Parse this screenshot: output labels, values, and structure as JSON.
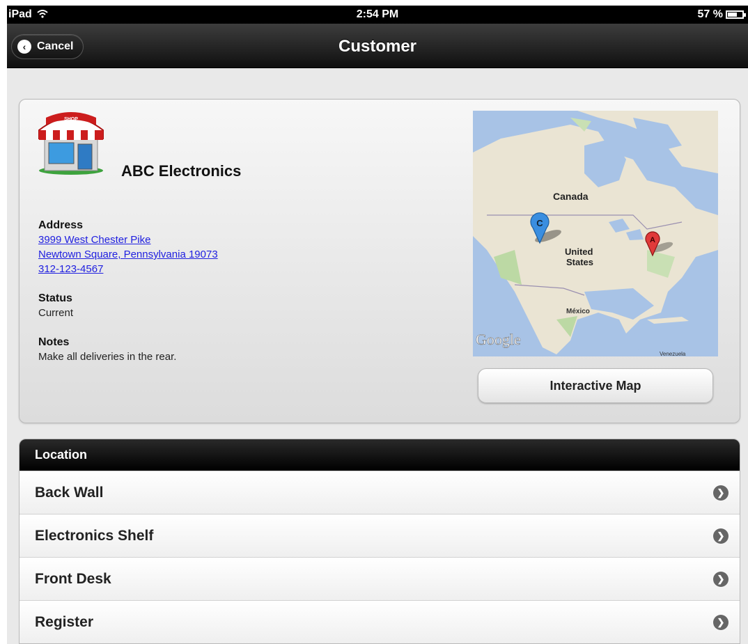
{
  "status_bar": {
    "carrier": "iPad",
    "time": "2:54 PM",
    "battery": "57 %"
  },
  "nav": {
    "cancel_label": "Cancel",
    "title": "Customer"
  },
  "customer": {
    "name": "ABC Electronics",
    "shop_sign": "SHOP",
    "address_label": "Address",
    "address_line1": "3999 West Chester Pike",
    "address_line2": "Newtown Square, Pennsylvania 19073",
    "phone": "312-123-4567",
    "status_label": "Status",
    "status_value": "Current",
    "notes_label": "Notes",
    "notes_value": "Make all deliveries in the rear."
  },
  "map": {
    "labels": {
      "canada": "Canada",
      "us_line1": "United",
      "us_line2": "States",
      "mexico": "México",
      "google": "Google",
      "venezuela": "Venezuela"
    },
    "markers": [
      {
        "letter": "C",
        "color": "#3a8ee0"
      },
      {
        "letter": "A",
        "color": "#e03a3a"
      }
    ],
    "button_label": "Interactive Map"
  },
  "location": {
    "header": "Location",
    "items": [
      "Back Wall",
      "Electronics Shelf",
      "Front Desk",
      "Register"
    ]
  }
}
